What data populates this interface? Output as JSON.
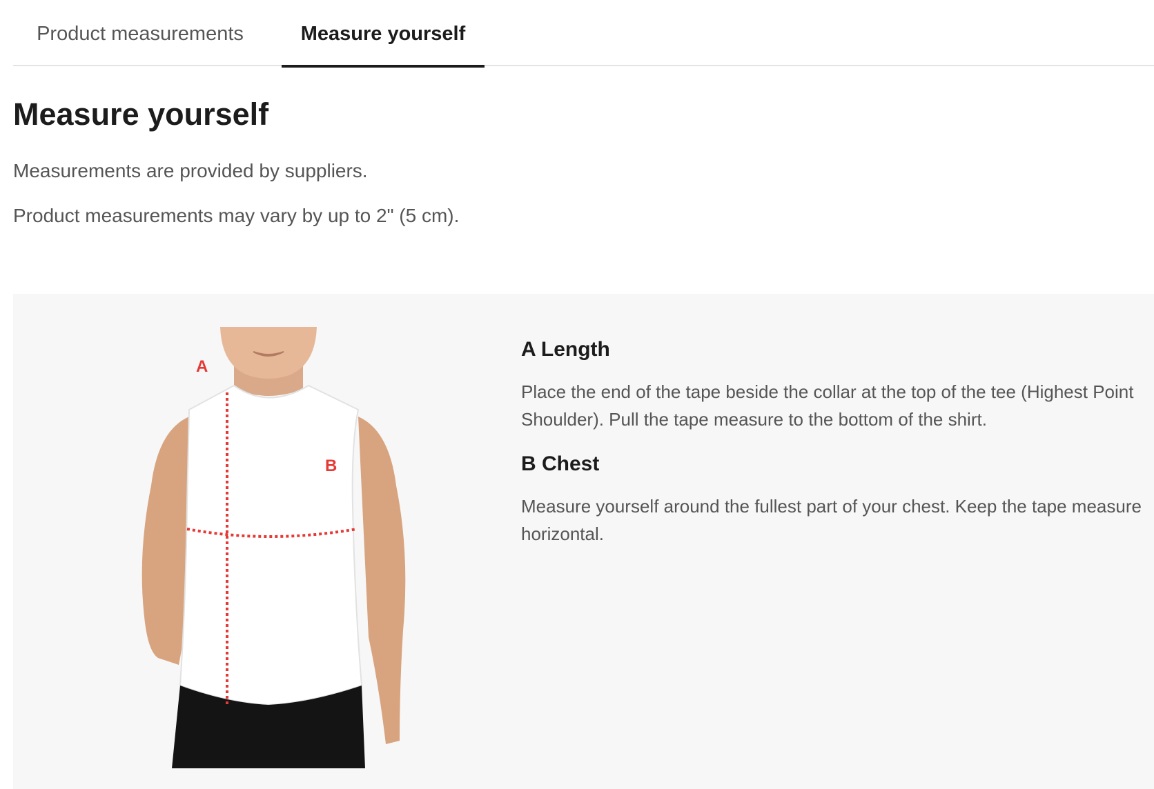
{
  "tabs": [
    {
      "label": "Product measurements",
      "active": false
    },
    {
      "label": "Measure yourself",
      "active": true
    }
  ],
  "section": {
    "title": "Measure yourself",
    "notes": [
      "Measurements are provided by suppliers.",
      "Product measurements may vary by up to 2\" (5 cm)."
    ]
  },
  "figure": {
    "marker_a": "A",
    "marker_b": "B",
    "marker_color": "#e53935"
  },
  "measurements": [
    {
      "title": "A Length",
      "text": "Place the end of the tape beside the collar at the top of the tee (Highest Point Shoulder). Pull the tape measure to the bottom of the shirt."
    },
    {
      "title": "B Chest",
      "text": "Measure yourself around the fullest part of your chest. Keep the tape measure horizontal."
    }
  ]
}
